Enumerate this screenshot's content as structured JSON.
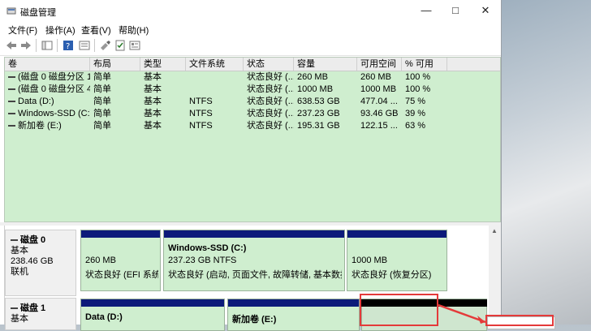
{
  "window": {
    "title": "磁盘管理"
  },
  "menu": [
    "文件(F)",
    "操作(A)",
    "查看(V)",
    "帮助(H)"
  ],
  "columns": [
    "卷",
    "布局",
    "类型",
    "文件系统",
    "状态",
    "容量",
    "可用空间",
    "% 可用"
  ],
  "volumes": [
    {
      "name": "(磁盘 0 磁盘分区 1)",
      "layout": "简单",
      "type": "基本",
      "fs": "",
      "status": "状态良好 (...",
      "capacity": "260 MB",
      "free": "260 MB",
      "pct": "100 %"
    },
    {
      "name": "(磁盘 0 磁盘分区 4)",
      "layout": "简单",
      "type": "基本",
      "fs": "",
      "status": "状态良好 (...",
      "capacity": "1000 MB",
      "free": "1000 MB",
      "pct": "100 %"
    },
    {
      "name": "Data (D:)",
      "layout": "简单",
      "type": "基本",
      "fs": "NTFS",
      "status": "状态良好 (...",
      "capacity": "638.53 GB",
      "free": "477.04 ...",
      "pct": "75 %"
    },
    {
      "name": "Windows-SSD (C:)",
      "layout": "简单",
      "type": "基本",
      "fs": "NTFS",
      "status": "状态良好 (...",
      "capacity": "237.23 GB",
      "free": "93.46 GB",
      "pct": "39 %"
    },
    {
      "name": "新加卷 (E:)",
      "layout": "简单",
      "type": "基本",
      "fs": "NTFS",
      "status": "状态良好 (...",
      "capacity": "195.31 GB",
      "free": "122.15 ...",
      "pct": "63 %"
    }
  ],
  "disks": [
    {
      "name": "磁盘 0",
      "kind": "基本",
      "size": "238.46 GB",
      "state": "联机",
      "partitions": [
        {
          "title": "",
          "line1": "260 MB",
          "line2": "状态良好 (EFI 系统分区)"
        },
        {
          "title": "Windows-SSD  (C:)",
          "line1": "237.23 GB NTFS",
          "line2": "状态良好 (启动, 页面文件, 故障转储, 基本数据分区)"
        },
        {
          "title": "",
          "line1": "1000 MB",
          "line2": "状态良好 (恢复分区)"
        }
      ]
    },
    {
      "name": "磁盘 1",
      "kind": "基本",
      "partitions": [
        {
          "title": "Data  (D:)"
        },
        {
          "title": "新加卷  (E:)"
        }
      ]
    }
  ]
}
